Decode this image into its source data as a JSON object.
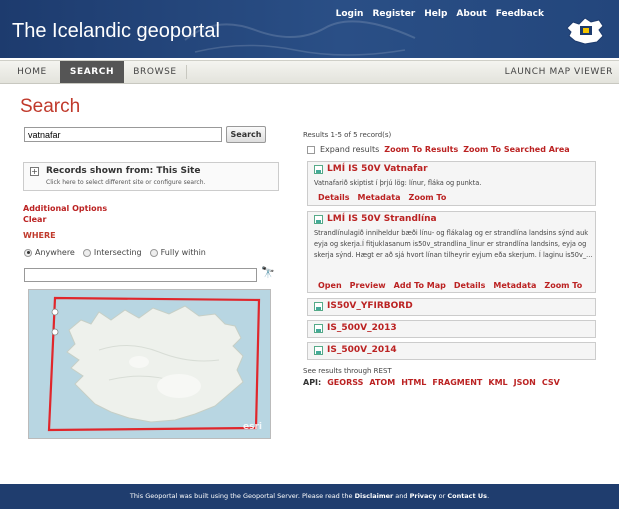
{
  "header": {
    "title": "The Icelandic geoportal",
    "links": [
      "Login",
      "Register",
      "Help",
      "About",
      "Feedback"
    ]
  },
  "nav": {
    "home": "HOME",
    "search": "SEARCH",
    "browse": "BROWSE",
    "launch": "LAUNCH MAP VIEWER"
  },
  "page": {
    "title": "Search"
  },
  "search": {
    "value": "vatnafar",
    "button": "Search"
  },
  "records": {
    "heading": "Records shown from: This Site",
    "sub": "Click here to select different site or configure search."
  },
  "options": {
    "additional": "Additional Options",
    "clear": "Clear",
    "where": "WHERE",
    "radios": [
      "Anywhere",
      "Intersecting",
      "Fully within"
    ],
    "selected": "Anywhere"
  },
  "map": {
    "attribution": "esri"
  },
  "results": {
    "count": "Results 1-5 of 5 record(s)",
    "expand_label": "Expand results",
    "zoom_results": "Zoom To Results",
    "zoom_area": "Zoom To Searched Area",
    "items": [
      {
        "title": "LMÍ IS 50V Vatnafar",
        "desc": "Vatnafarið skiptist í þrjú lög: línur, fláka og punkta.",
        "links": [
          "Details",
          "Metadata",
          "Zoom To"
        ]
      },
      {
        "title": "LMÍ IS 50V Strandlína",
        "desc": "Strandlínulagið inniheldur bæði línu- og flákalag og er strandlína landsins sýnd auk eyja og skerja.Í fitjuklasanum is50v_strandlina_linur er strandlína landsins, eyja og skerja sýnd. Hægt er að sjá hvort línan tilheyrir eyjum eða skerjum. Í laginu is50v_...",
        "links": [
          "Open",
          "Preview",
          "Add To Map",
          "Details",
          "Metadata",
          "Zoom To"
        ]
      },
      {
        "title": "IS50V_YFIRBORD"
      },
      {
        "title": "IS_500V_2013"
      },
      {
        "title": "IS_500V_2014"
      }
    ],
    "rest_label": "See results through REST",
    "api_label": "API:",
    "api_links": [
      "GEORSS",
      "ATOM",
      "HTML",
      "FRAGMENT",
      "KML",
      "JSON",
      "CSV"
    ]
  },
  "footer": {
    "pre": "This Geoportal was built using the Geoportal Server. Please read the",
    "disclaimer": "Disclaimer",
    "and": "and",
    "privacy": "Privacy",
    "or": "or",
    "contact": "Contact Us",
    "end": "."
  }
}
